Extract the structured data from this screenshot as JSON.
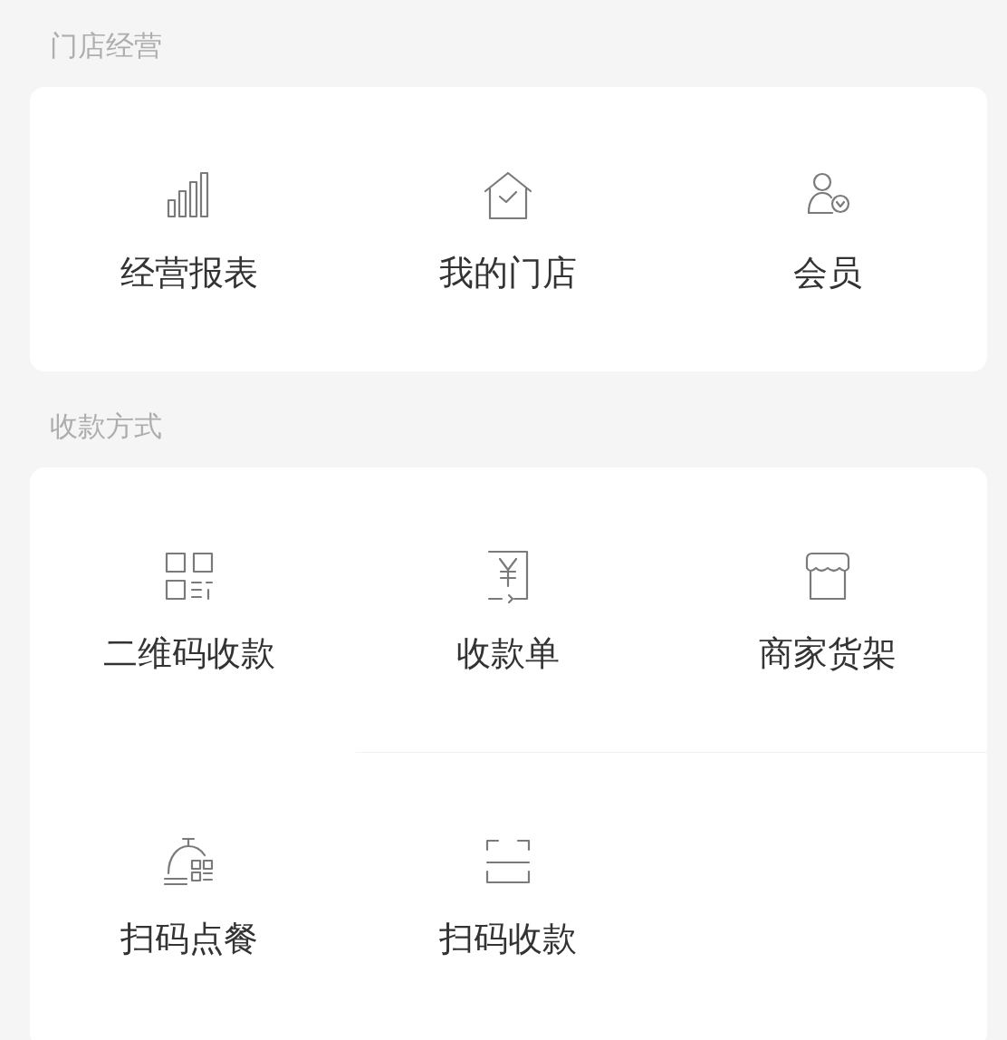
{
  "sections": [
    {
      "title": "门店经营",
      "items": [
        {
          "label": "经营报表"
        },
        {
          "label": "我的门店"
        },
        {
          "label": "会员"
        }
      ]
    },
    {
      "title": "收款方式",
      "items": [
        {
          "label": "二维码收款"
        },
        {
          "label": "收款单"
        },
        {
          "label": "商家货架"
        },
        {
          "label": "扫码点餐"
        },
        {
          "label": "扫码收款"
        }
      ]
    }
  ]
}
